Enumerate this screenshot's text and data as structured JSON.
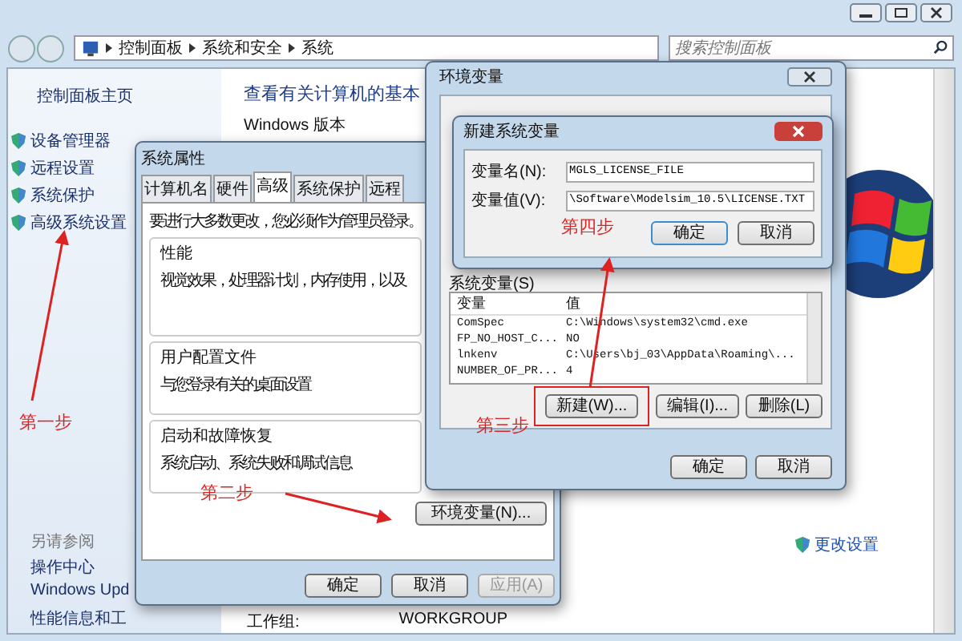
{
  "window": {
    "breadcrumbs": [
      "控制面板",
      "系统和安全",
      "系统"
    ],
    "search": {
      "placeholder": "搜索控制面板"
    }
  },
  "sidebar": {
    "home": "控制面板主页",
    "items": [
      {
        "label": "设备管理器"
      },
      {
        "label": "远程设置"
      },
      {
        "label": "系统保护"
      },
      {
        "label": "高级系统设置"
      }
    ],
    "see_also_title": "另请参阅",
    "see_also": [
      "操作中心",
      "Windows Upd",
      "性能信息和工"
    ]
  },
  "main": {
    "heading": "查看有关计算机的基本",
    "windows_edition": "Windows 版本",
    "workgroup_label": "工作组:",
    "workgroup_value": "WORKGROUP",
    "change_settings": "更改设置"
  },
  "system_properties": {
    "title": "系统属性",
    "tabs": [
      {
        "label": "计算机名",
        "selected": false
      },
      {
        "label": "硬件",
        "selected": false
      },
      {
        "label": "高级",
        "selected": true
      },
      {
        "label": "系统保护",
        "selected": false
      },
      {
        "label": "远程",
        "selected": false
      }
    ],
    "notice": "要进行大多数更改，您必须作为管理员登录。",
    "groups": [
      {
        "title": "性能",
        "description": "视觉效果，处理器计划，内存使用，以及"
      },
      {
        "title": "用户配置文件",
        "description": "与您登录有关的桌面设置"
      },
      {
        "title": "启动和故障恢复",
        "description": "系统启动、系统失败和调试信息"
      }
    ],
    "env_button": "环境变量(N)...",
    "buttons": [
      {
        "label": "确定",
        "disabled": false
      },
      {
        "label": "取消",
        "disabled": false
      },
      {
        "label": "应用(A)",
        "disabled": true
      }
    ]
  },
  "env_dialog": {
    "title": "环境变量",
    "system_vars_label": "系统变量(S)",
    "columns": [
      "变量",
      "值"
    ],
    "rows": [
      {
        "name": "ComSpec",
        "value": "C:\\Windows\\system32\\cmd.exe"
      },
      {
        "name": "FP_NO_HOST_C...",
        "value": "NO"
      },
      {
        "name": "lnkenv",
        "value": "C:\\Users\\bj_03\\AppData\\Roaming\\..."
      },
      {
        "name": "NUMBER_OF_PR...",
        "value": "4"
      }
    ],
    "buttons": [
      {
        "label": "新建(W)...",
        "highlighted": true
      },
      {
        "label": "编辑(I)...",
        "highlighted": false
      },
      {
        "label": "删除(L)",
        "highlighted": false
      }
    ],
    "footer_buttons": [
      "确定",
      "取消"
    ]
  },
  "new_var_dialog": {
    "title": "新建系统变量",
    "fields": [
      {
        "label": "变量名(N):",
        "value": "MGLS_LICENSE_FILE"
      },
      {
        "label": "变量值(V):",
        "value": "\\Software\\Modelsim_10.5\\LICENSE.TXT"
      }
    ],
    "buttons": [
      "确定",
      "取消"
    ]
  },
  "annotations": [
    "第一步",
    "第二步",
    "第三步",
    "第四步"
  ]
}
